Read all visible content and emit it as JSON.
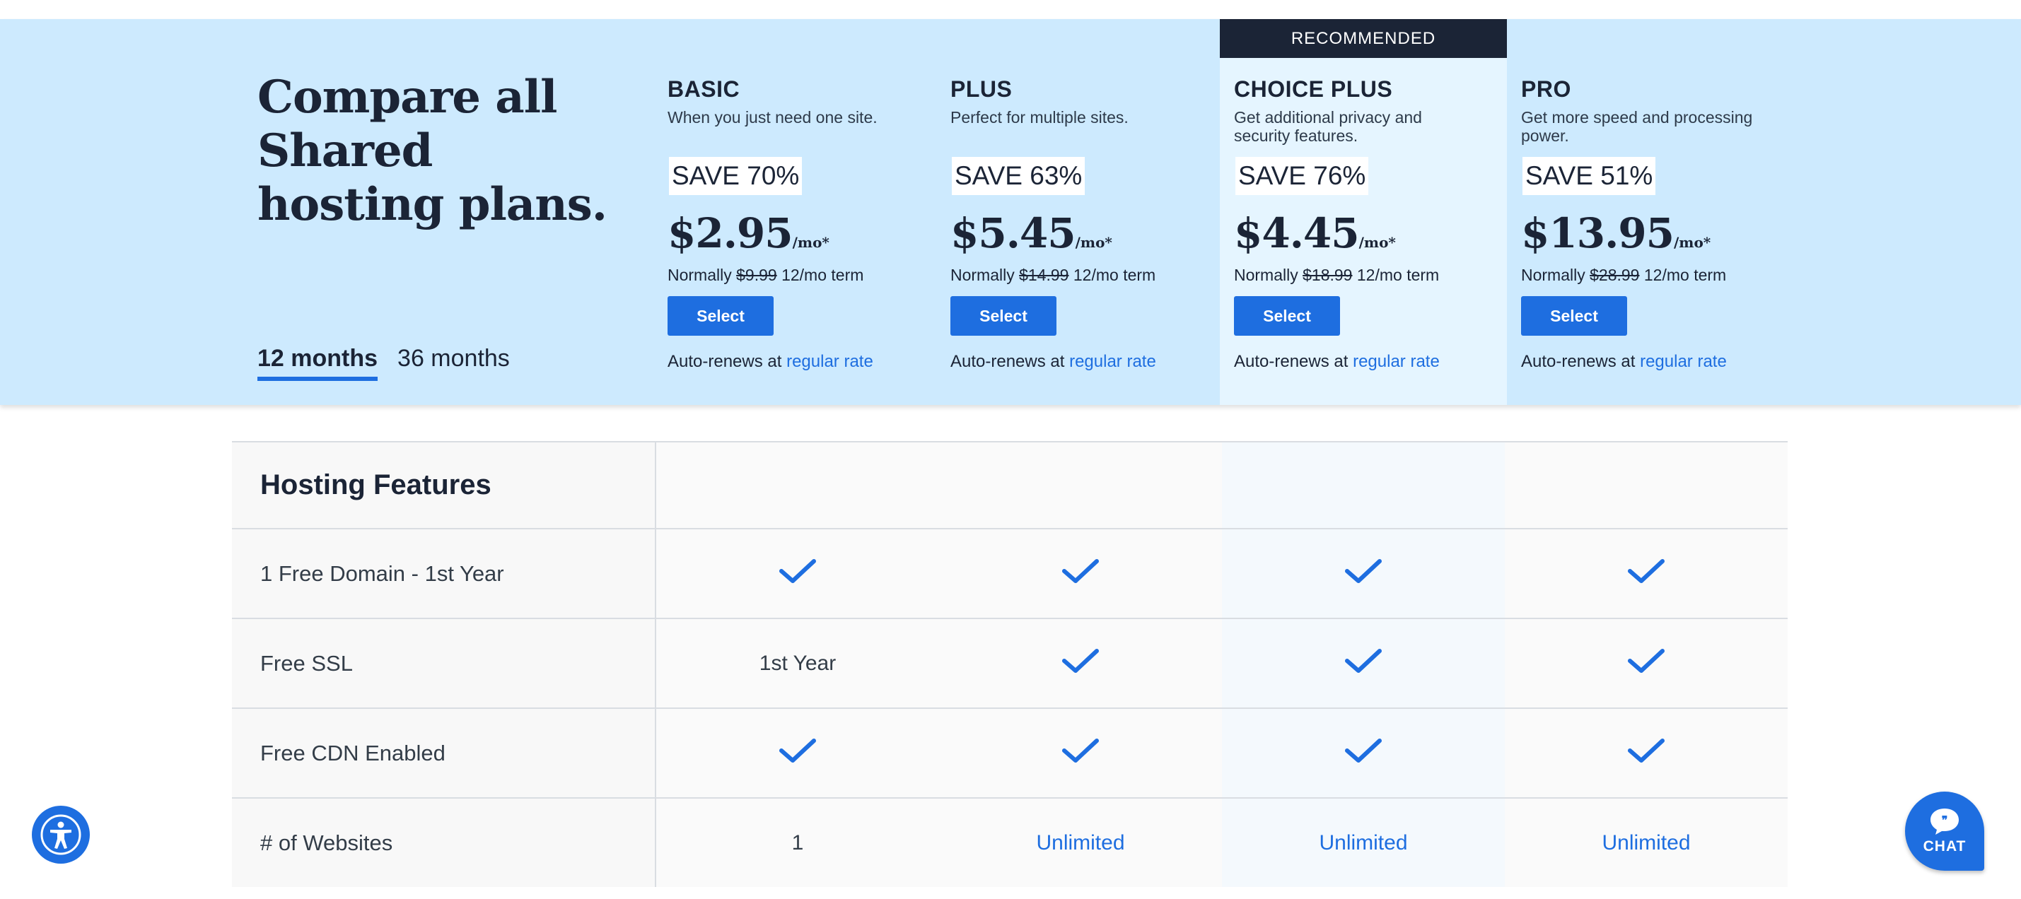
{
  "page_title": "Compare all Shared hosting plans.",
  "recommended_label": "RECOMMENDED",
  "term_tabs": [
    {
      "label": "12 months",
      "active": true
    },
    {
      "label": "36 months",
      "active": false
    }
  ],
  "plans": [
    {
      "name": "BASIC",
      "desc": "When you just need one site.",
      "save": "SAVE 70%",
      "price": "$2.95",
      "unit": "/mo*",
      "normally": "Normally",
      "old_price": "$9.99",
      "term": "12/mo term",
      "select": "Select",
      "renew_text": "Auto-renews at",
      "renew_link": "regular rate"
    },
    {
      "name": "PLUS",
      "desc": "Perfect for multiple sites.",
      "save": "SAVE 63%",
      "price": "$5.45",
      "unit": "/mo*",
      "normally": "Normally",
      "old_price": "$14.99",
      "term": "12/mo term",
      "select": "Select",
      "renew_text": "Auto-renews at",
      "renew_link": "regular rate"
    },
    {
      "name": "CHOICE PLUS",
      "desc": "Get additional privacy and security features.",
      "save": "SAVE 76%",
      "price": "$4.45",
      "unit": "/mo*",
      "normally": "Normally",
      "old_price": "$18.99",
      "term": "12/mo term",
      "select": "Select",
      "renew_text": "Auto-renews at",
      "renew_link": "regular rate"
    },
    {
      "name": "PRO",
      "desc": "Get more speed and processing power.",
      "save": "SAVE 51%",
      "price": "$13.95",
      "unit": "/mo*",
      "normally": "Normally",
      "old_price": "$28.99",
      "term": "12/mo term",
      "select": "Select",
      "renew_text": "Auto-renews at",
      "renew_link": "regular rate"
    }
  ],
  "features": {
    "heading": "Hosting Features",
    "rows": [
      {
        "label": "1 Free Domain - 1st Year",
        "cells": [
          {
            "type": "check"
          },
          {
            "type": "check"
          },
          {
            "type": "check"
          },
          {
            "type": "check"
          }
        ]
      },
      {
        "label": "Free SSL",
        "cells": [
          {
            "type": "text",
            "value": "1st Year"
          },
          {
            "type": "check"
          },
          {
            "type": "check"
          },
          {
            "type": "check"
          }
        ]
      },
      {
        "label": "Free CDN Enabled",
        "cells": [
          {
            "type": "check"
          },
          {
            "type": "check"
          },
          {
            "type": "check"
          },
          {
            "type": "check"
          }
        ]
      },
      {
        "label": "# of Websites",
        "cells": [
          {
            "type": "text",
            "value": "1"
          },
          {
            "type": "link",
            "value": "Unlimited"
          },
          {
            "type": "link",
            "value": "Unlimited"
          },
          {
            "type": "link",
            "value": "Unlimited"
          }
        ]
      }
    ]
  },
  "chat_label": "CHAT",
  "icons": {
    "check": "check-icon",
    "accessibility": "accessibility-icon",
    "chat": "chat-bubble-icon"
  },
  "colors": {
    "accent": "#1e6ee0",
    "header_bg": "#cdeafe",
    "dark": "#1b2436"
  }
}
